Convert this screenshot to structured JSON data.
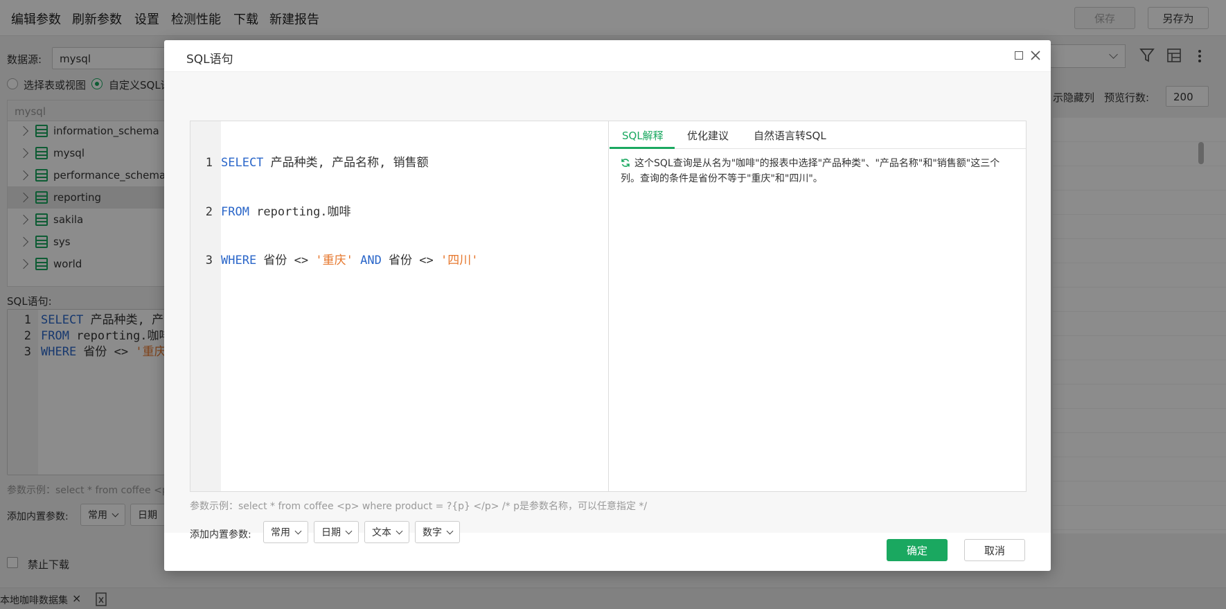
{
  "menu": {
    "items": [
      "编辑参数",
      "刷新参数",
      "设置",
      "检测性能",
      "下载",
      "新建报告"
    ],
    "save_label": "保存",
    "save_as_label": "另存为"
  },
  "left": {
    "datasource_label": "数据源:",
    "datasource_value": "mysql",
    "radio_tables": "选择表或视图",
    "radio_custom": "自定义SQL语",
    "tree_head": "mysql",
    "databases": [
      "information_schema",
      "mysql",
      "performance_schema",
      "reporting",
      "sakila",
      "sys",
      "world"
    ],
    "sql_label": "SQL语句:",
    "sql_lines": [
      {
        "num": "1",
        "kw": "SELECT",
        "rest": " 产品种类, 产品"
      },
      {
        "num": "2",
        "kw": "FROM",
        "rest": " reporting.咖啡"
      },
      {
        "num": "3",
        "kw": "WHERE",
        "rest": " 省份 <> ",
        "str": "'重庆'"
      }
    ],
    "param_example": "参数示例：select * from coffee <p",
    "builtin_label": "添加内置参数:",
    "dd_common": "常用",
    "dd_date": "日期",
    "disable_download": "禁止下载"
  },
  "right": {
    "show_hidden": "示隐藏列",
    "preview_rows_label": "预览行数:",
    "preview_rows_value": "200"
  },
  "bottom_tab": {
    "label": "本地咖啡数据集",
    "close": "×"
  },
  "modal": {
    "title": "SQL语句",
    "code": {
      "line1": {
        "num": "1",
        "kw": "SELECT",
        "rest": " 产品种类, 产品名称, 销售额"
      },
      "line2": {
        "num": "2",
        "kw": "FROM",
        "rest": " reporting.咖啡"
      },
      "line3": {
        "num": "3",
        "kw1": "WHERE",
        "t1": " 省份 <> ",
        "s1": "'重庆'",
        "kw2": " AND",
        "t2": " 省份 <> ",
        "s2": "'四川'"
      }
    },
    "tabs": [
      "SQL解释",
      "优化建议",
      "自然语言转SQL"
    ],
    "explanation": "这个SQL查询是从名为\"咖啡\"的报表中选择\"产品种类\"、\"产品名称\"和\"销售额\"这三个列。查询的条件是省份不等于\"重庆\"和\"四川\"。",
    "param_example": "参数示例：select * from coffee <p> where product = ?{p} </p> /* p是参数名称，可以任意指定 */",
    "builtin_label": "添加内置参数:",
    "dropdowns": [
      "常用",
      "日期",
      "文本",
      "数字"
    ],
    "ok_label": "确定",
    "cancel_label": "取消"
  },
  "colors": {
    "accent": "#1aa860",
    "keyword": "#2a66c9",
    "string": "#e6762b"
  }
}
